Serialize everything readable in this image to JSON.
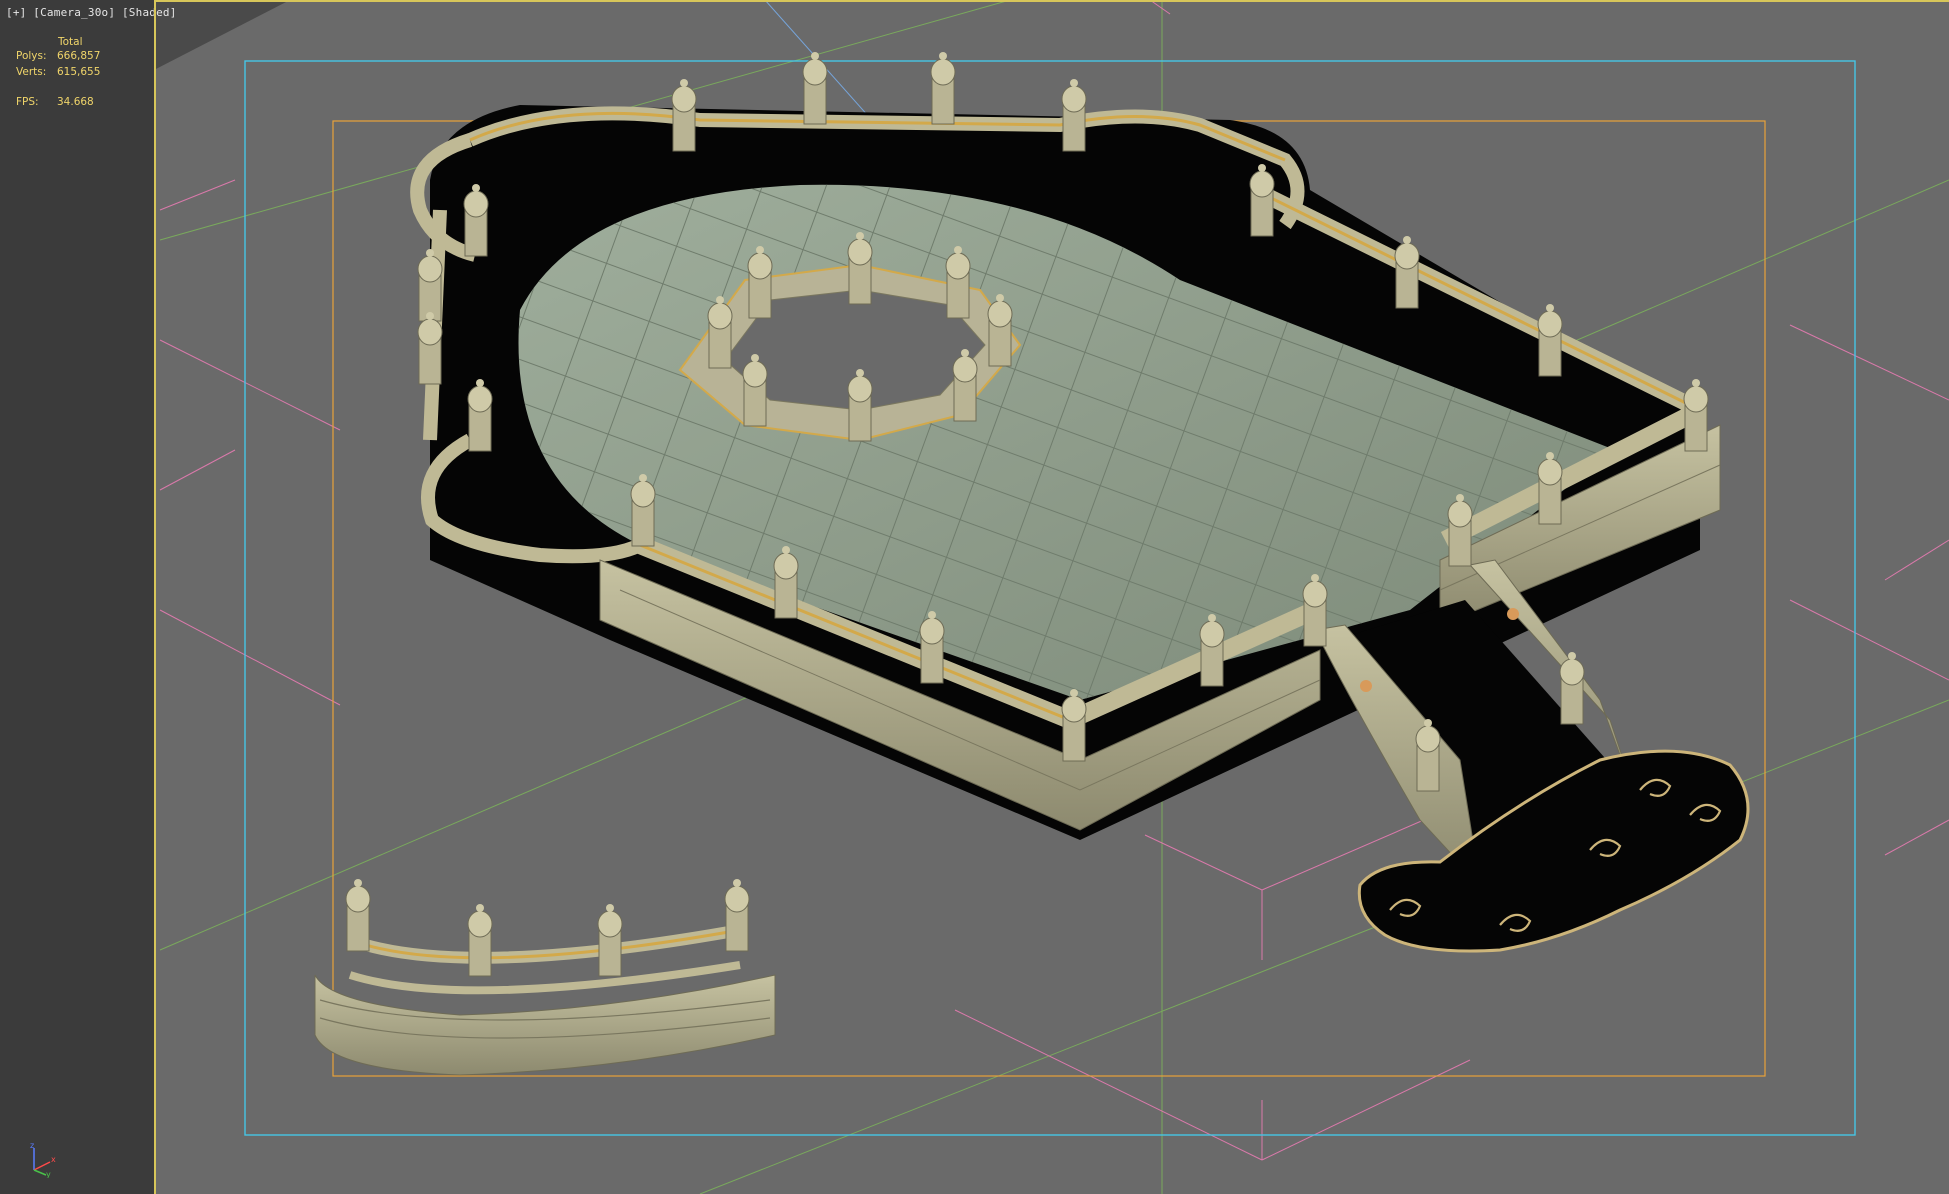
{
  "viewport": {
    "label": "[+] [Camera_30o] [Shaded]"
  },
  "stats": {
    "total_header": "Total",
    "rows": [
      {
        "label": "Polys:",
        "value": "666,857"
      },
      {
        "label": "Verts:",
        "value": "615,655"
      },
      {
        "label": "FPS:",
        "value": "34.668"
      }
    ]
  },
  "axis_gizmo": {
    "z_label": "z",
    "x_label": "x",
    "y_label": "y"
  },
  "colors": {
    "safe_frame_outer": "#46c6e6",
    "safe_frame_inner": "#e8a23a",
    "viewport_border": "#d7c65a",
    "stone": "#aaa88c",
    "floor": "#8c9a86",
    "shadow": "#050505"
  }
}
